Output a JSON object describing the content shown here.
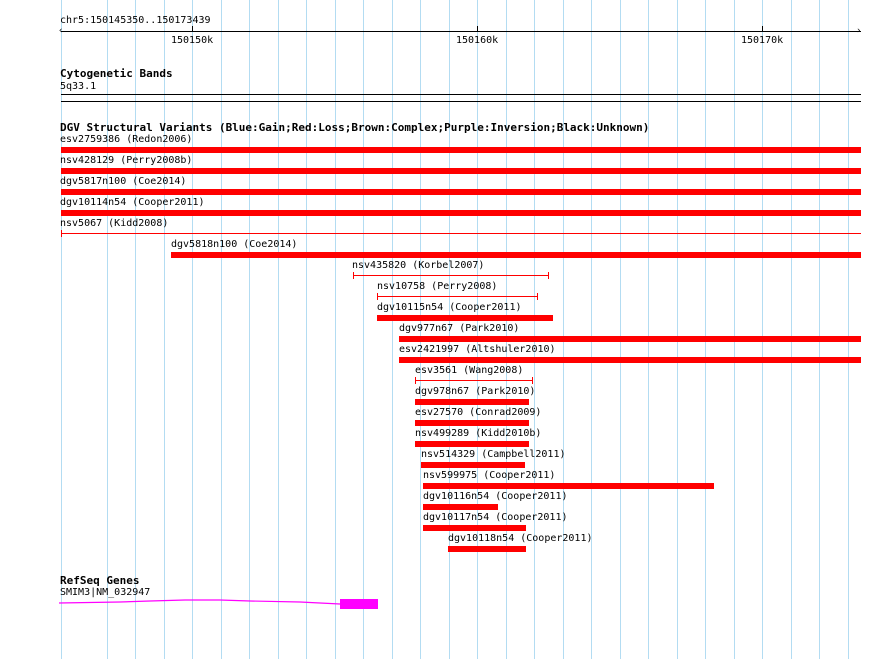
{
  "ruler": {
    "location": "chr5:150145350..150173439",
    "ticks": [
      "150150k",
      "150160k",
      "150170k"
    ]
  },
  "cytoband": {
    "title": "Cytogenetic Bands",
    "band": "5q33.1"
  },
  "dgv": {
    "title": "DGV Structural Variants (Blue:Gain;Red:Loss;Brown:Complex;Purple:Inversion;Black:Unknown)",
    "colors": {
      "loss": "#ff0000"
    },
    "variants": [
      {
        "label": "esv2759386 (Redon2006)",
        "style": "thick"
      },
      {
        "label": "nsv428129 (Perry2008b)",
        "style": "thick"
      },
      {
        "label": "dgv5817n100 (Coe2014)",
        "style": "thick"
      },
      {
        "label": "dgv10114n54 (Cooper2011)",
        "style": "thick"
      },
      {
        "label": "nsv5067 (Kidd2008)",
        "style": "thin"
      },
      {
        "label": "dgv5818n100 (Coe2014)",
        "style": "thick"
      },
      {
        "label": "nsv435820 (Korbel2007)",
        "style": "thin"
      },
      {
        "label": "nsv10758 (Perry2008)",
        "style": "thin"
      },
      {
        "label": "dgv10115n54 (Cooper2011)",
        "style": "thick"
      },
      {
        "label": "dgv977n67 (Park2010)",
        "style": "thick"
      },
      {
        "label": "esv2421997 (Altshuler2010)",
        "style": "thick"
      },
      {
        "label": "esv3561 (Wang2008)",
        "style": "thin"
      },
      {
        "label": "dgv978n67 (Park2010)",
        "style": "thick"
      },
      {
        "label": "esv27570 (Conrad2009)",
        "style": "thick"
      },
      {
        "label": "nsv499289 (Kidd2010b)",
        "style": "thick"
      },
      {
        "label": "nsv514329 (Campbell2011)",
        "style": "thick"
      },
      {
        "label": "nsv599975 (Cooper2011)",
        "style": "thick"
      },
      {
        "label": "dgv10116n54 (Cooper2011)",
        "style": "thick"
      },
      {
        "label": "dgv10117n54 (Cooper2011)",
        "style": "thick"
      },
      {
        "label": "dgv10118n54 (Cooper2011)",
        "style": "thick"
      }
    ]
  },
  "refseq": {
    "title": "RefSeq Genes",
    "gene_label": "SMIM3|NM_032947",
    "color": "#ff00ff"
  }
}
